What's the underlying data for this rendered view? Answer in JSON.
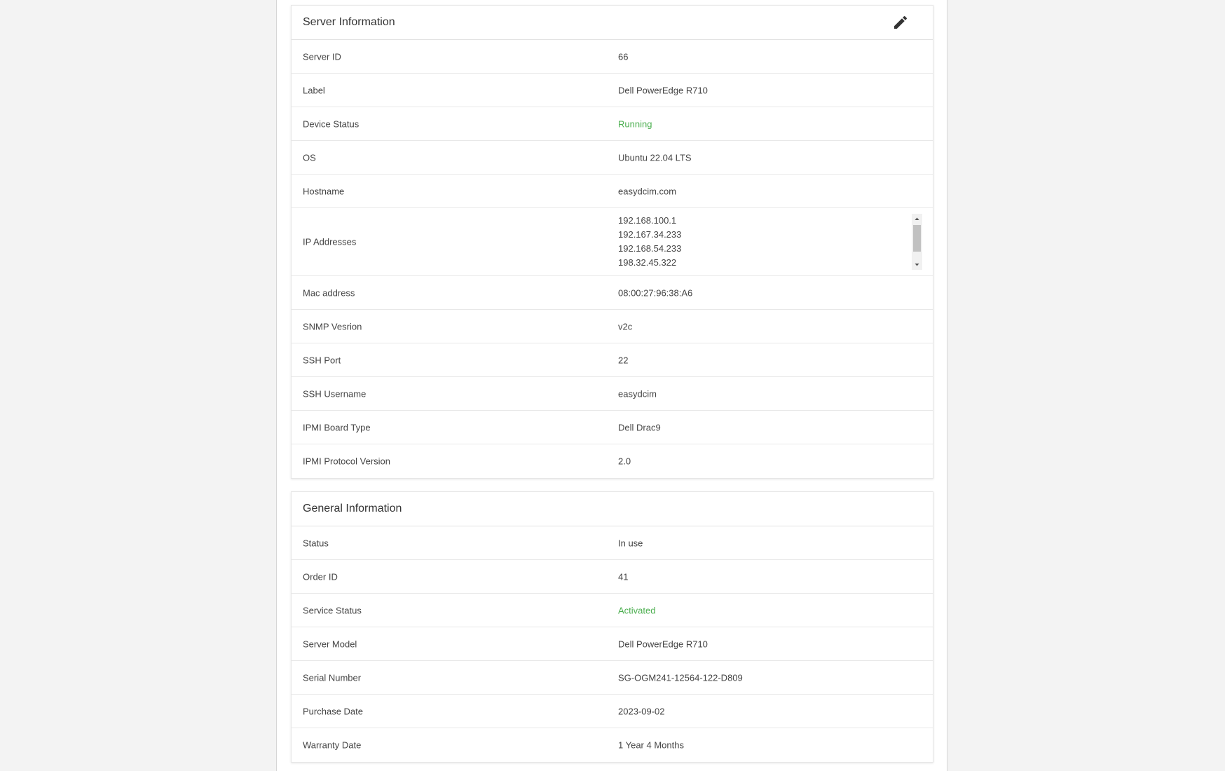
{
  "server_info": {
    "title": "Server Information",
    "edit_icon": "pencil-icon",
    "rows": [
      {
        "label": "Server ID",
        "value": "66"
      },
      {
        "label": "Label",
        "value": "Dell PowerEdge R710"
      },
      {
        "label": "Device Status",
        "value": "Running"
      },
      {
        "label": "OS",
        "value": "Ubuntu 22.04 LTS"
      },
      {
        "label": "Hostname",
        "value": "easydcim.com"
      },
      {
        "label": "IP Addresses",
        "values": [
          "192.168.100.1",
          "192.167.34.233",
          "192.168.54.233",
          "198.32.45.322"
        ]
      },
      {
        "label": "Mac address",
        "value": "08:00:27:96:38:A6"
      },
      {
        "label": "SNMP Vesrion",
        "value": "v2c"
      },
      {
        "label": "SSH Port",
        "value": "22"
      },
      {
        "label": "SSH Username",
        "value": "easydcim"
      },
      {
        "label": "IPMI Board Type",
        "value": "Dell Drac9"
      },
      {
        "label": "IPMI Protocol Version",
        "value": "2.0"
      }
    ]
  },
  "general_info": {
    "title": "General Information",
    "rows": [
      {
        "label": "Status",
        "value": "In use"
      },
      {
        "label": "Order ID",
        "value": "41"
      },
      {
        "label": "Service Status",
        "value": "Activated"
      },
      {
        "label": "Server Model",
        "value": "Dell PowerEdge R710"
      },
      {
        "label": "Serial Number",
        "value": "SG-OGM241-12564-122-D809"
      },
      {
        "label": "Purchase Date",
        "value": "2023-09-02"
      },
      {
        "label": "Warranty Date",
        "value": "1 Year 4 Months"
      }
    ]
  },
  "colors": {
    "status_green": "#4caf50",
    "background": "#f3f3f3",
    "card_border": "#e6e6e6"
  }
}
